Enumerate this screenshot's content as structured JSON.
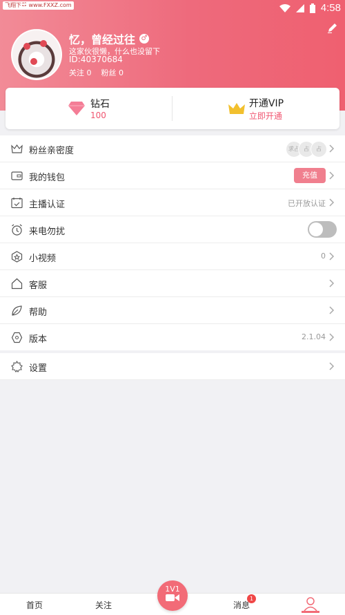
{
  "status": {
    "left_badge": "飞翔下载 www.FXXZ.com",
    "time": "4:58"
  },
  "profile": {
    "name": "忆，曾经过往",
    "gender_symbol": "♂",
    "signature": "这家伙很懒，什么也没留下",
    "id": "ID:40370684",
    "following": "关注 0",
    "fans": "粉丝 0"
  },
  "wallet_card": {
    "diamond_label": "钻石",
    "diamond_value": "100",
    "vip_label": "开通VIP",
    "vip_action": "立即开通"
  },
  "menu": {
    "items": [
      {
        "label": "粉丝亲密度",
        "value": ""
      },
      {
        "label": "我的钱包",
        "value": "充值"
      },
      {
        "label": "主播认证",
        "value": "已开放认证"
      },
      {
        "label": "来电勿扰",
        "value": ""
      },
      {
        "label": "小视频",
        "value": "0"
      },
      {
        "label": "客服",
        "value": ""
      },
      {
        "label": "帮助",
        "value": ""
      },
      {
        "label": "版本",
        "value": "2.1.04"
      }
    ],
    "avatar_placeholders": [
      "求占",
      "占",
      "占"
    ],
    "settings": "设置"
  },
  "bottom_nav": {
    "home": "首页",
    "follow": "关注",
    "center": "1V1",
    "messages": "消息",
    "messages_badge": "1"
  },
  "colors": {
    "accent": "#ee6a7c",
    "brand_pink": "#f26b77"
  }
}
